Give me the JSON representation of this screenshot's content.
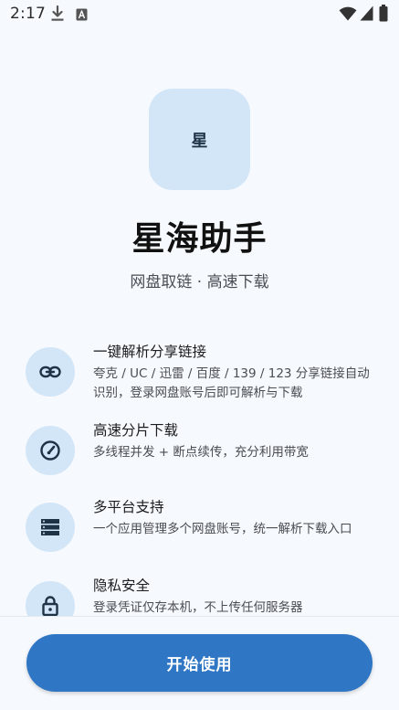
{
  "status_bar": {
    "time": "2:17",
    "icons": [
      "download-icon",
      "keyboard-a-icon",
      "wifi-icon",
      "cellular-signal-icon",
      "battery-icon"
    ]
  },
  "logo": {
    "text": "星",
    "tile_color": "#d3e6f8"
  },
  "app": {
    "title": "星海助手",
    "subtitle": "网盘取链 · 高速下载"
  },
  "features": [
    {
      "icon": "link-icon",
      "title": "一键解析分享链接",
      "description": "夸克 / UC / 迅雷 / 百度 / 139 / 123 分享链接自动识别，登录网盘账号后即可解析与下载"
    },
    {
      "icon": "speedometer-icon",
      "title": "高速分片下载",
      "description": "多线程并发 + 断点续传，充分利用带宽"
    },
    {
      "icon": "storage-list-icon",
      "title": "多平台支持",
      "description": "一个应用管理多个网盘账号，统一解析下载入口"
    },
    {
      "icon": "lock-icon",
      "title": "隐私安全",
      "description": "登录凭证仅存本机，不上传任何服务器"
    }
  ],
  "actions": {
    "start_label": "开始使用"
  },
  "colors": {
    "accent": "#2f76c4",
    "icon_bg": "#d3e6f8",
    "icon_fg": "#1f3347",
    "background": "#f6f9fd"
  }
}
